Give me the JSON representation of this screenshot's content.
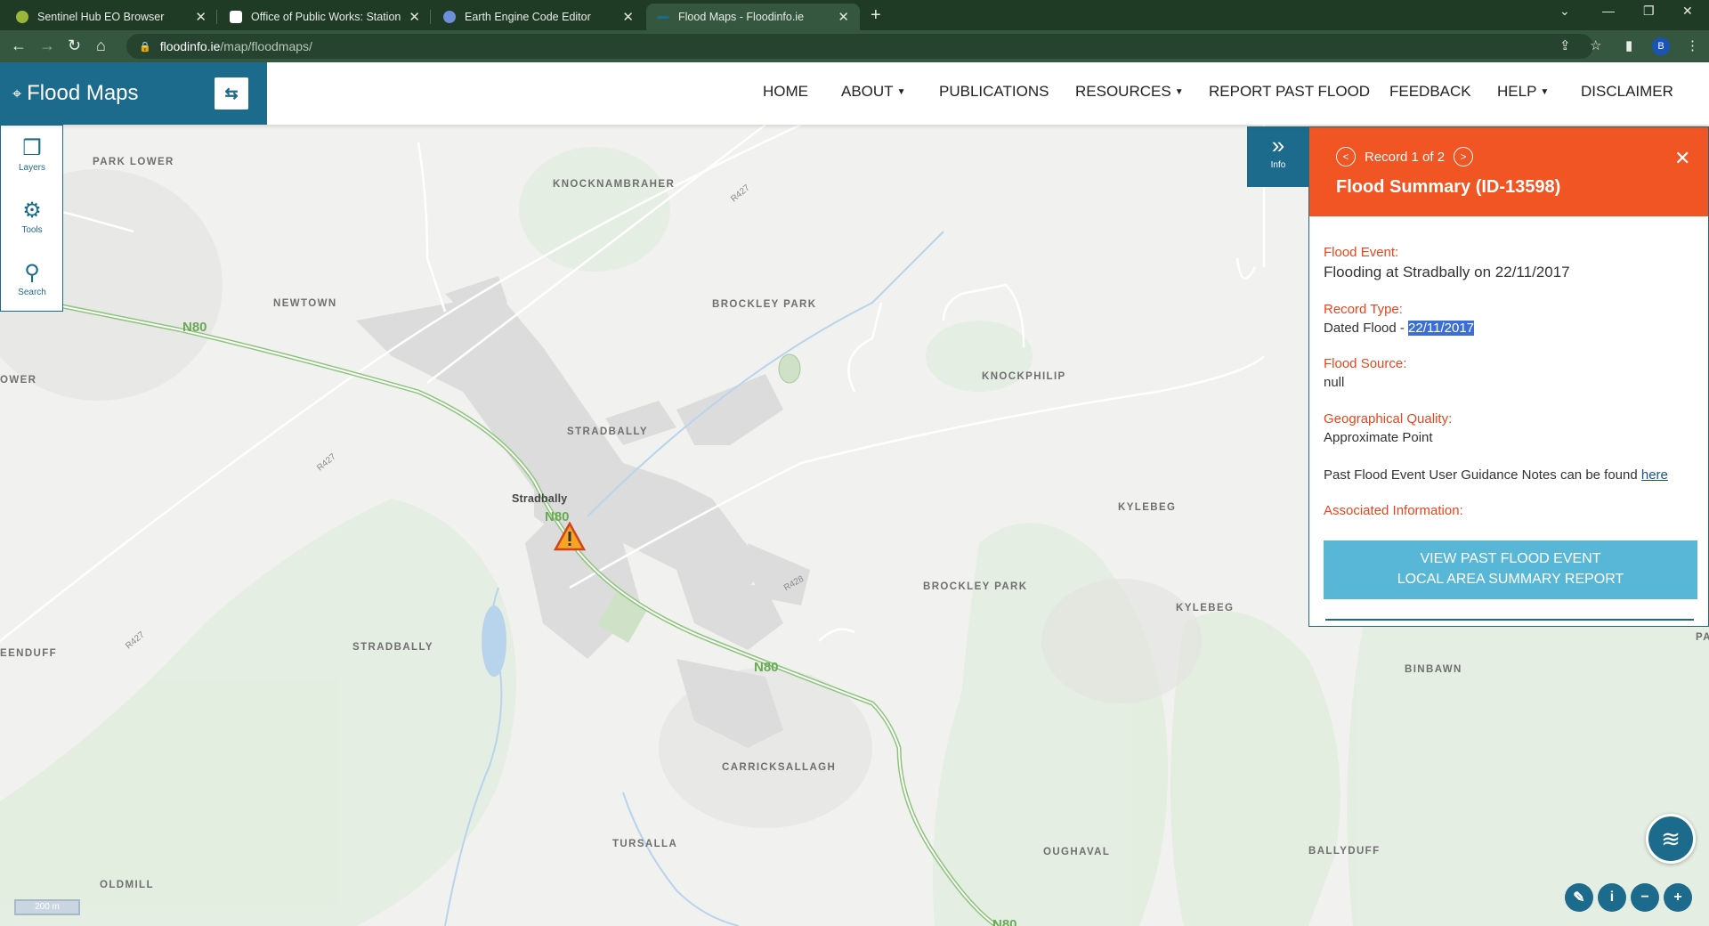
{
  "browser": {
    "tabs": [
      {
        "title": "Sentinel Hub EO Browser",
        "icon_color": "#9cb63a"
      },
      {
        "title": "Office of Public Works: Station Sc",
        "icon_color": "#e04a2a"
      },
      {
        "title": "Earth Engine Code Editor",
        "icon_color": "#6b8fd8"
      },
      {
        "title": "Flood Maps - Floodinfo.ie",
        "icon_color": "#1c6b8c"
      }
    ],
    "active_tab": 3,
    "url_host": "floodinfo.ie",
    "url_path": "/map/floodmaps/",
    "profile_initial": "B"
  },
  "header": {
    "brand": "Flood Maps",
    "nav": [
      {
        "label": "HOME",
        "dropdown": false
      },
      {
        "label": "ABOUT",
        "dropdown": true
      },
      {
        "label": "PUBLICATIONS",
        "dropdown": false
      },
      {
        "label": "RESOURCES",
        "dropdown": true
      },
      {
        "label": "REPORT PAST FLOOD",
        "dropdown": false
      },
      {
        "label": "FEEDBACK",
        "dropdown": false
      },
      {
        "label": "HELP",
        "dropdown": true
      },
      {
        "label": "DISCLAIMER",
        "dropdown": false
      }
    ]
  },
  "toolbar": {
    "layers": "Layers",
    "tools": "Tools",
    "search": "Search"
  },
  "info_toggle": "Info",
  "panel": {
    "record_text": "Record 1 of 2",
    "title": "Flood Summary (ID-13598)",
    "flood_event_label": "Flood Event:",
    "flood_event_value": "Flooding at Stradbally on 22/11/2017",
    "record_type_label": "Record Type:",
    "record_type_prefix": "Dated Flood - ",
    "record_type_date": "22/11/2017",
    "flood_source_label": "Flood Source:",
    "flood_source_value": "null",
    "geo_quality_label": "Geographical Quality:",
    "geo_quality_value": "Approximate Point",
    "guidance_text": "Past Flood Event User Guidance Notes can be found ",
    "guidance_link": "here",
    "associated_label": "Associated Information:",
    "report_button_line1": "VIEW PAST FLOOD EVENT",
    "report_button_line2": "LOCAL AREA SUMMARY REPORT"
  },
  "map": {
    "labels": [
      "PARK LOWER",
      "KNOCKNAMBRAHER",
      "NEWTOWN",
      "BROCKLEY PARK",
      "OWER",
      "KNOCKPHILIP",
      "STRADBALLY",
      "Stradbally",
      "KYLEBEG",
      "BROCKLEY PARK",
      "KYLEBEG",
      "EENDUFF",
      "STRADBALLY",
      "BINBAWN",
      "PA",
      "CARRICKSALLAGH",
      "TURSALLA",
      "OUGHAVAL",
      "BALLYDUFF",
      "OLDMILL"
    ],
    "road_labels": [
      "N80",
      "N80",
      "N80",
      "N80",
      "R427",
      "R427",
      "R427",
      "R428"
    ],
    "scale": "200 m"
  },
  "colors": {
    "brand": "#1c6b8c",
    "panel_header": "#f05523",
    "label_accent": "#e8451e",
    "report_button": "#58b7d7",
    "road_green": "#6aaa55"
  }
}
